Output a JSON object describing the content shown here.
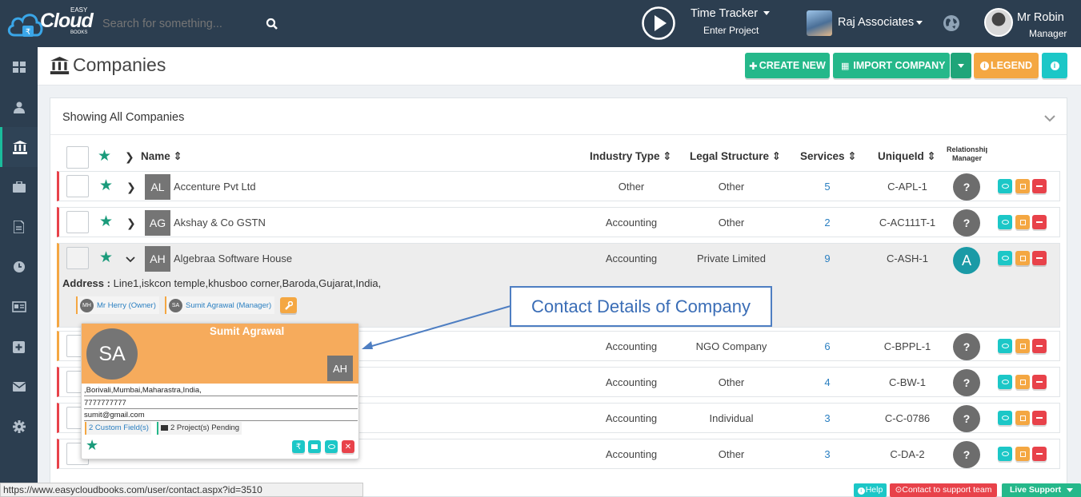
{
  "brand": {
    "logo_top": "EASY",
    "logo_main": "Cloud",
    "logo_sub": "BOOKS"
  },
  "search": {
    "placeholder": "Search for something..."
  },
  "tracker": {
    "title": "Time Tracker",
    "sub": "Enter Project"
  },
  "org": {
    "name": "Raj Associates"
  },
  "user": {
    "name": "Mr Robin",
    "role": "Manager"
  },
  "page": {
    "title": "Companies"
  },
  "buttons": {
    "create": "CREATE NEW",
    "import": "IMPORT COMPANY",
    "legend": "LEGEND"
  },
  "panel": {
    "heading": "Showing All Companies"
  },
  "columns": {
    "name": "Name",
    "industry": "Industry Type",
    "legal": "Legal Structure",
    "services": "Services",
    "unique": "UniqueId",
    "relation": "Relationship",
    "manager": "Manager"
  },
  "rows": [
    {
      "initials": "AL",
      "name": "Accenture Pvt Ltd",
      "industry": "Other",
      "legal": "Other",
      "services": "5",
      "uid": "C-APL-1",
      "rm": "?"
    },
    {
      "initials": "AG",
      "name": "Akshay & Co GSTN",
      "industry": "Accounting",
      "legal": "Other",
      "services": "2",
      "uid": "C-AC111T-1",
      "rm": "?"
    },
    {
      "initials": "AH",
      "name": "Algebraa Software House",
      "industry": "Accounting",
      "legal": "Private Limited",
      "services": "9",
      "uid": "C-ASH-1",
      "rm": "A"
    },
    {
      "initials": "",
      "name": "",
      "industry": "Accounting",
      "legal": "NGO Company",
      "services": "6",
      "uid": "C-BPPL-1",
      "rm": "?"
    },
    {
      "initials": "",
      "name": "",
      "industry": "Accounting",
      "legal": "Other",
      "services": "4",
      "uid": "C-BW-1",
      "rm": "?"
    },
    {
      "initials": "",
      "name": "",
      "industry": "Accounting",
      "legal": "Individual",
      "services": "3",
      "uid": "C-C-0786",
      "rm": "?"
    },
    {
      "initials": "",
      "name": "",
      "industry": "Accounting",
      "legal": "Other",
      "services": "3",
      "uid": "C-DA-2",
      "rm": "?"
    }
  ],
  "expanded": {
    "address_label": "Address :",
    "address": "Line1,iskcon temple,khusboo corner,Baroda,Gujarat,India,",
    "contacts": [
      {
        "initials": "MH",
        "label": "Mr Herry (Owner)"
      },
      {
        "initials": "SA",
        "label": "Sumit Agrawal (Manager)"
      }
    ]
  },
  "popup": {
    "name": "Sumit Agrawal",
    "initials": "SA",
    "company_initials": "AH",
    "address": ",Borivali,Mumbai,Maharastra,India,",
    "phone": "7777777777",
    "email": "sumit@gmail.com",
    "custom": "2 Custom Field(s)",
    "projects": "2 Project(s) Pending"
  },
  "callout": {
    "text": "Contact Details of Company"
  },
  "status": {
    "url": "https://www.easycloudbooks.com/user/contact.aspx?id=3510",
    "help": "Help",
    "contact": "Contact to support team",
    "live": "Live Support"
  },
  "colors": {
    "topbar": "#2c3e50",
    "accent": "#1abc9c",
    "teal": "#1cc7c7",
    "orange": "#f4a742",
    "red": "#e8424a",
    "green_btn": "#25b88a"
  }
}
